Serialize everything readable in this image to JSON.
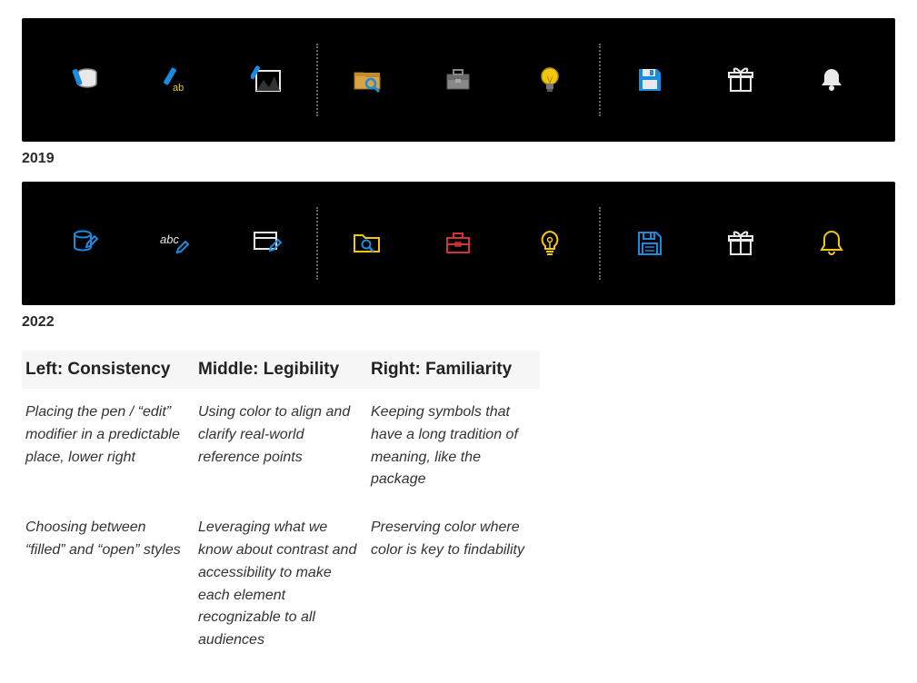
{
  "rows": [
    {
      "year": "2019"
    },
    {
      "year": "2022"
    }
  ],
  "principles": {
    "col1": {
      "heading": "Left: Consistency",
      "p1": "Placing the pen / “edit” modifier in a predictable place, lower right",
      "p2": "Choosing between “filled” and “open” styles"
    },
    "col2": {
      "heading": "Middle: Legibility",
      "p1": "Using color to align and clarify real-world reference points",
      "p2": "Leveraging what we know about contrast and accessibility to make each element recognizable to all audiences"
    },
    "col3": {
      "heading": "Right: Familiarity",
      "p1": "Keeping symbols that have a long tradition of meaning, like the package",
      "p2": "Preserving color where color is key to findability"
    }
  },
  "colors": {
    "blue": "#1b8be0",
    "yellow": "#f2c80f",
    "red": "#d13438",
    "gray": "#a0a0a0",
    "white": "#e8e8e8"
  }
}
